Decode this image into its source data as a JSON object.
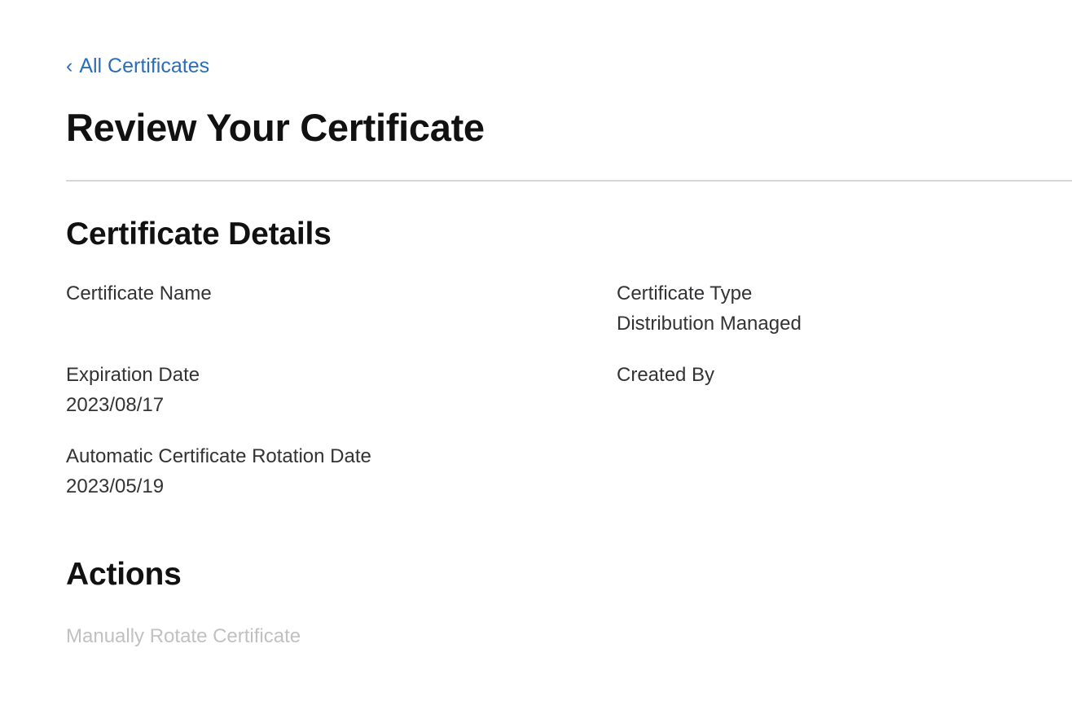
{
  "nav": {
    "back_icon": "‹",
    "back_label": "All Certificates"
  },
  "page_title": "Review Your Certificate",
  "details": {
    "heading": "Certificate Details",
    "certificate_name": {
      "label": "Certificate Name",
      "value": ""
    },
    "certificate_type": {
      "label": "Certificate Type",
      "value": "Distribution Managed"
    },
    "expiration_date": {
      "label": "Expiration Date",
      "value": "2023/08/17"
    },
    "created_by": {
      "label": "Created By",
      "value": ""
    },
    "rotation_date": {
      "label": "Automatic Certificate Rotation Date",
      "value": "2023/05/19"
    }
  },
  "actions": {
    "heading": "Actions",
    "manual_rotate_label": "Manually Rotate Certificate"
  },
  "colors": {
    "link": "#2a6ebb",
    "disabled": "#c1c1c4",
    "divider": "#d7d7d9"
  }
}
